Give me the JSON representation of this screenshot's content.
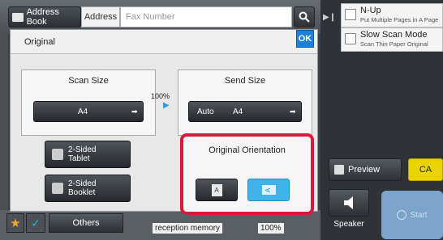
{
  "top_bar": {
    "address_book_label": "Address Book",
    "address_tab_label": "Address",
    "fax_placeholder": "Fax Number"
  },
  "right_panel": {
    "options": [
      {
        "title": "N-Up",
        "subtitle": "Put Multiple Pages in A Page"
      },
      {
        "title": "Slow Scan Mode",
        "subtitle": "Scan Thin Paper Original"
      }
    ],
    "preview_label": "Preview",
    "ca_label": "CA",
    "speaker_label": "Speaker",
    "start_label": "Start"
  },
  "dialog": {
    "title": "Original",
    "ok_label": "OK",
    "scan_size": {
      "label": "Scan Size",
      "value": "A4"
    },
    "ratio": "100%",
    "send_size": {
      "label": "Send Size",
      "mode": "Auto",
      "value": "A4"
    },
    "two_sided_tablet": "2-Sided\nTablet",
    "two_sided_booklet": "2-Sided\nBooklet",
    "orientation": {
      "title": "Original Orientation",
      "portrait_glyph": "A",
      "landscape_glyph": "A",
      "selected": "landscape"
    }
  },
  "bottom": {
    "others_label": "Others",
    "memory_label": "reception memory",
    "memory_value": "100%"
  },
  "colors": {
    "highlight_border": "#d61c3a",
    "selected_blue": "#3fb3ea",
    "ca_yellow": "#e9d300",
    "ok_blue": "#1e7fd6"
  }
}
